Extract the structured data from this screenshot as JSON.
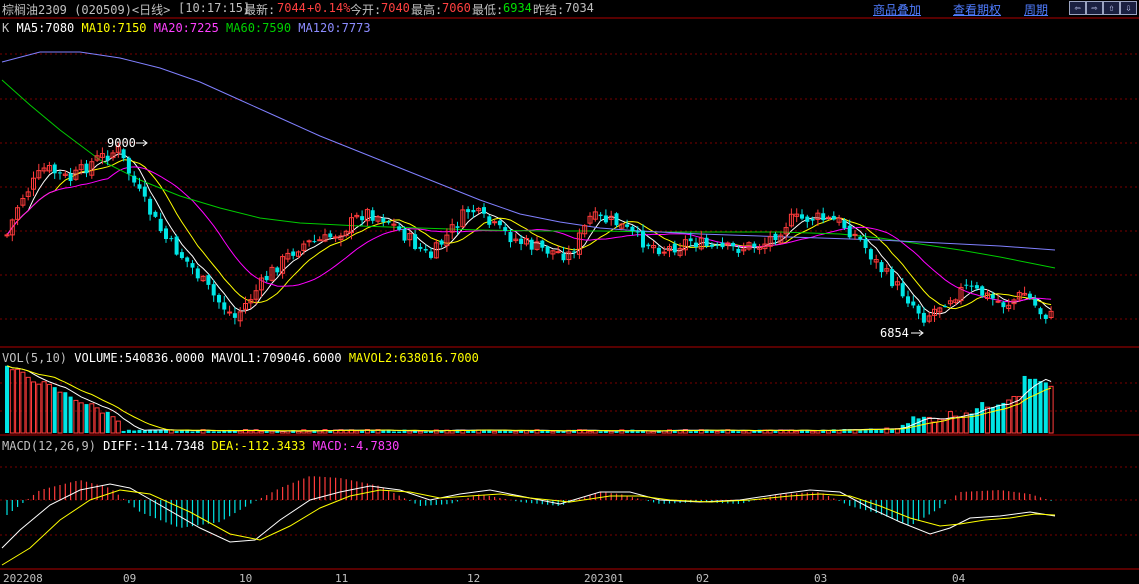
{
  "header": {
    "title": "棕榈油2309 (020509)<日线>",
    "time": "[10:17:15]",
    "latest_label": "最新:",
    "latest_value": "7044",
    "change": "+0.14%",
    "open_label": "今开:",
    "open_value": "7040",
    "high_label": "最高:",
    "high_value": "7060",
    "low_label": "最低:",
    "low_value": "6934",
    "prev_label": "昨结:",
    "prev_value": "7034",
    "links": [
      "商品叠加",
      "查看期权",
      "周期"
    ],
    "nav_icons": [
      "scroll-left-icon",
      "scroll-right-icon",
      "zoom-in-icon",
      "zoom-out-icon"
    ]
  },
  "price_legend": {
    "k": "K",
    "ma5": "MA5:7080",
    "ma10": "MA10:7150",
    "ma20": "MA20:7225",
    "ma60": "MA60:7590",
    "ma120": "MA120:7773"
  },
  "annotations": {
    "high_mark": "9000",
    "low_mark": "6854"
  },
  "volume_legend": {
    "vol": "VOL(5,10)",
    "volume": "VOLUME:540836.0000",
    "mavol1": "MAVOL1:709046.6000",
    "mavol2": "MAVOL2:638016.7000"
  },
  "macd_legend": {
    "macd_name": "MACD(12,26,9)",
    "diff": "DIFF:-114.7348",
    "dea": "DEA:-112.3433",
    "macd": "MACD:-4.7830"
  },
  "x_labels": [
    "202208",
    "09",
    "10",
    "11",
    "12",
    "202301",
    "02",
    "03",
    "04"
  ],
  "colors": {
    "up": "#ff3b3b",
    "down": "#00e5e5",
    "ma5": "#ffffff",
    "ma10": "#ffff00",
    "ma20": "#ff00ff",
    "ma60": "#00cc00",
    "ma120": "#8080ff",
    "grid": "#7a0000",
    "link": "#4f7cff"
  }
}
